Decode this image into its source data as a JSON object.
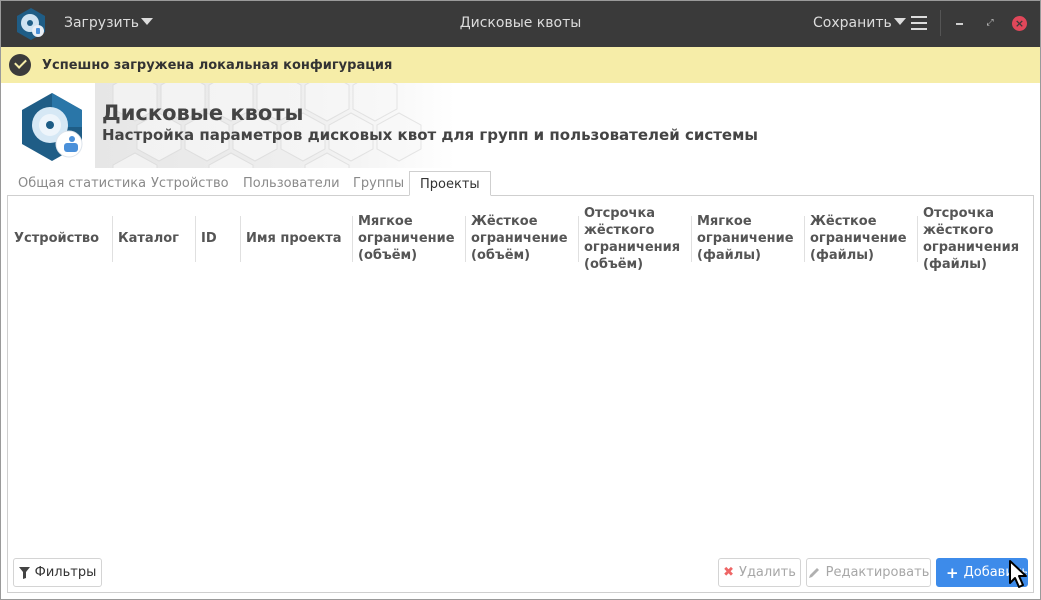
{
  "titlebar": {
    "load_label": "Загрузить",
    "title": "Дисковые квоты",
    "save_label": "Сохранить",
    "max_glyph": "⤢",
    "close_glyph": "×"
  },
  "notification": {
    "text": "Успешно загружена локальная конфигурация"
  },
  "header": {
    "title": "Дисковые квоты",
    "subtitle": "Настройка параметров дисковых квот для групп и пользователей системы"
  },
  "tabs": [
    {
      "label": "Общая статистика"
    },
    {
      "label": "Устройство"
    },
    {
      "label": "Пользователи"
    },
    {
      "label": "Группы"
    },
    {
      "label": "Проекты"
    }
  ],
  "active_tab": "Проекты",
  "table": {
    "columns": [
      "Устройство",
      "Каталог",
      "ID",
      "Имя проекта",
      "Мягкое ограничение (объём)",
      "Жёсткое ограничение (объём)",
      "Отсрочка жёсткого ограничения (объём)",
      "Мягкое ограничение (файлы)",
      "Жёсткое ограничение (файлы)",
      "Отсрочка жёсткого ограничения (файлы)"
    ],
    "rows": []
  },
  "buttons": {
    "filters": "Фильтры",
    "delete": "Удалить",
    "edit": "Редактировать",
    "add": "Добавить"
  },
  "icons": {
    "app": "disk-quota-icon",
    "notify": "check-circle-icon"
  },
  "colors": {
    "titlebar_bg": "#3a3a3a",
    "notify_bg": "#f6eda8",
    "accent": "#3d8bea",
    "close_red": "#e0475a"
  }
}
